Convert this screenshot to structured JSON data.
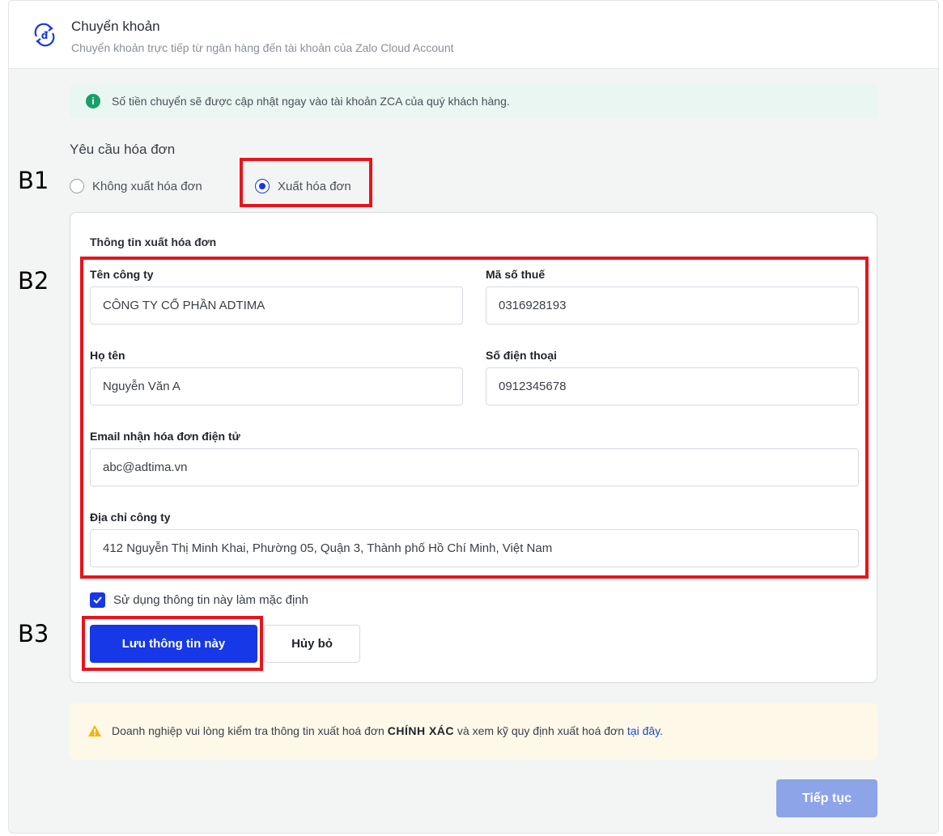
{
  "header": {
    "title": "Chuyển khoản",
    "subtitle": "Chuyển khoản trực tiếp từ ngân hàng đến tài khoản của Zalo Cloud Account",
    "icon": "transfer-dong-icon"
  },
  "info_banner": {
    "text": "Số tiền chuyển sẽ được cập nhật ngay vào tài khoản ZCA của quý khách hàng.",
    "icon": "info-icon"
  },
  "invoice_request": {
    "title": "Yêu cầu hóa đơn",
    "options": [
      {
        "label": "Không xuất hóa đơn",
        "selected": false
      },
      {
        "label": "Xuất hóa đơn",
        "selected": true
      }
    ]
  },
  "invoice_form": {
    "title": "Thông tin xuất hóa đơn",
    "fields": {
      "company_name": {
        "label": "Tên công ty",
        "value": "CÔNG TY CỔ PHẦN ADTIMA"
      },
      "tax_code": {
        "label": "Mã số thuế",
        "value": "0316928193"
      },
      "full_name": {
        "label": "Họ tên",
        "value": "Nguyễn Văn A"
      },
      "phone": {
        "label": "Số điện thoại",
        "value": "0912345678"
      },
      "email": {
        "label": "Email nhận hóa đơn điện tử",
        "value": "abc@adtima.vn"
      },
      "address": {
        "label": "Địa chỉ công ty",
        "value": "412 Nguyễn Thị Minh Khai, Phường 05, Quận 3, Thành phố Hồ Chí Minh, Việt Nam"
      }
    },
    "default_checkbox": {
      "label": "Sử dụng thông tin này làm mặc định",
      "checked": true
    },
    "save_label": "Lưu thông tin này",
    "cancel_label": "Hủy bỏ"
  },
  "warning": {
    "text_before": "Doanh nghiệp vui lòng kiểm tra thông tin xuất hoá đơn ",
    "emphasis": "CHÍNH XÁC",
    "text_middle": " và xem kỹ quy định xuất hoá đơn ",
    "link": "tại đây",
    "text_after": "."
  },
  "next_label": "Tiếp tục",
  "annotations": {
    "step1": "B1",
    "step2": "B2",
    "step3": "B3"
  },
  "colors": {
    "primary": "#1638e6",
    "primary_disabled": "#8ea4e8",
    "annotation_red": "#e8141b",
    "info_green": "#1a9e6c",
    "warning_yellow": "#f5b400"
  }
}
